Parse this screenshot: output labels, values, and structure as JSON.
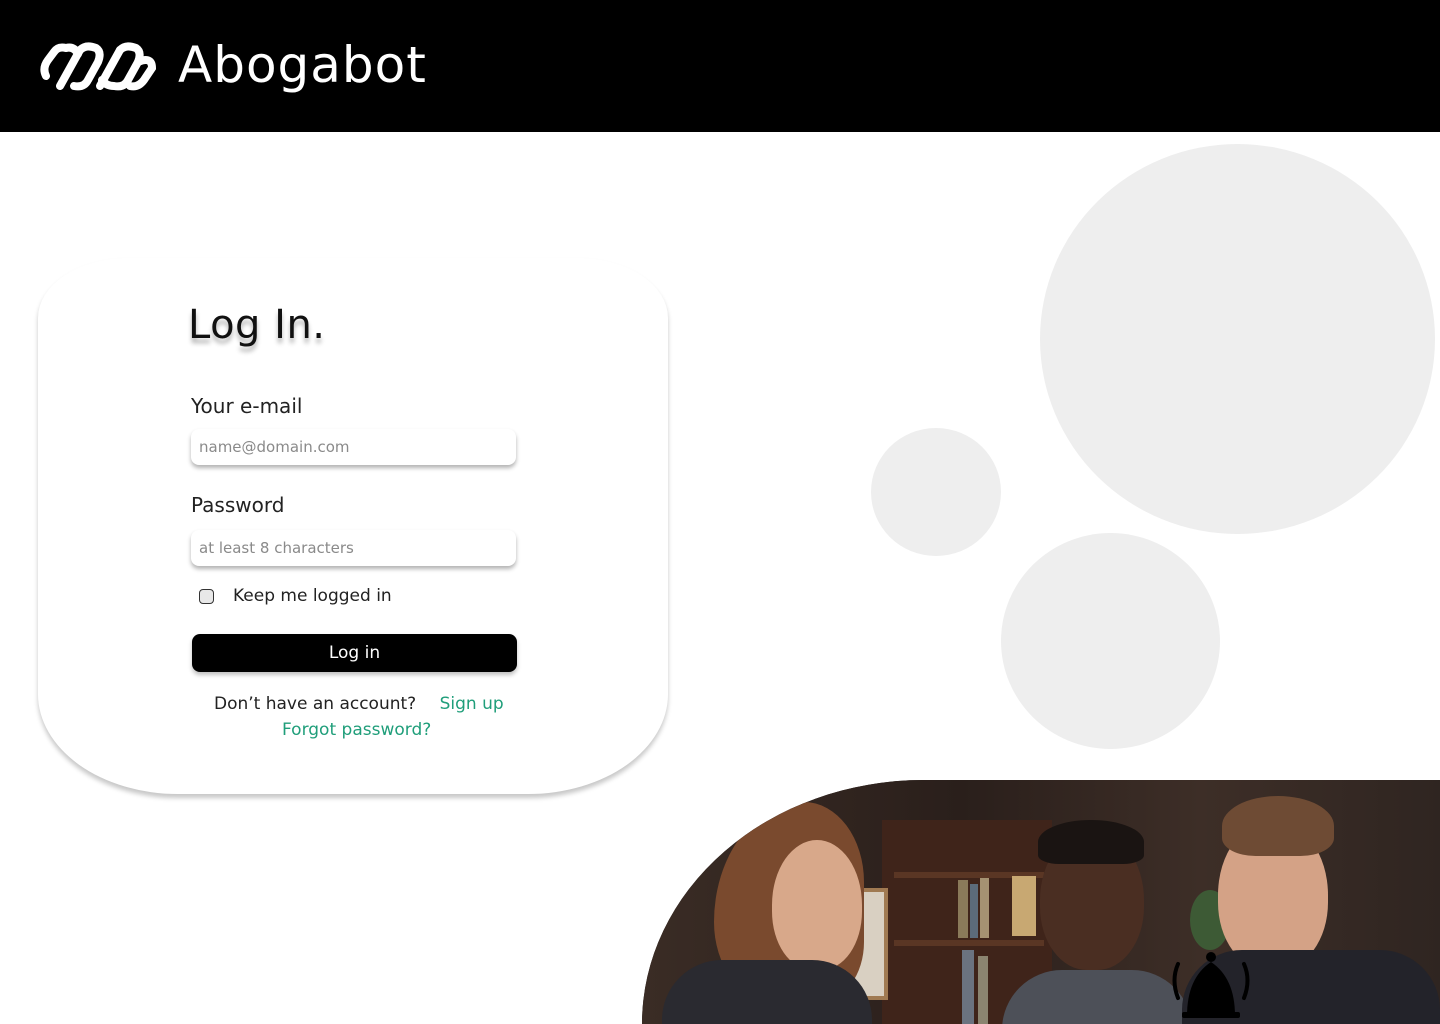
{
  "header": {
    "brand": "Abogabot",
    "logo_icon": "chain-link-icon"
  },
  "login": {
    "title": "Log In.",
    "email_label": "Your e-mail",
    "email_placeholder": "name@domain.com",
    "email_value": "",
    "password_label": "Password",
    "password_placeholder": "at least 8 characters",
    "password_value": "",
    "keep_logged_in_label": "Keep me logged in",
    "keep_logged_in_checked": false,
    "login_button": "Log in",
    "no_account_text": "Don’t have an account?",
    "signup_link": "Sign up",
    "forgot_link": "Forgot password?"
  },
  "colors": {
    "header_bg": "#000000",
    "accent_link": "#1f9e7a",
    "circle_fill": "#eeeeee"
  },
  "photo": {
    "subject": "three-people-in-office-photo",
    "overlay_icon": "bell-icon"
  }
}
